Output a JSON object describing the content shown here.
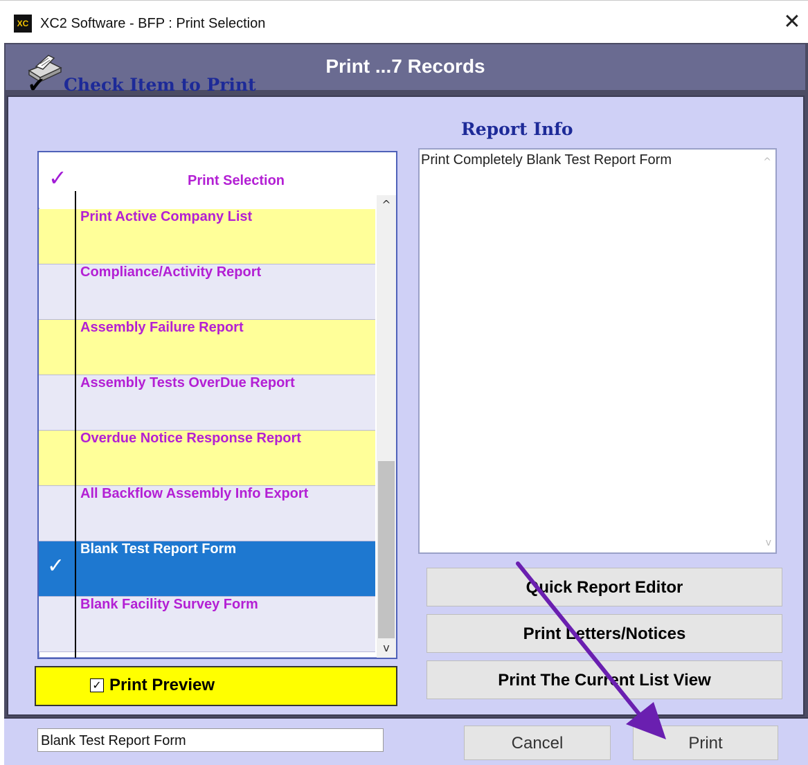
{
  "window": {
    "app_icon_text": "XC",
    "title": "XC2 Software - BFP : Print Selection",
    "close_glyph": "✕"
  },
  "header": {
    "title": "Print ...7 Records",
    "icon": "printer-icon"
  },
  "left_panel": {
    "heading_check": "✔",
    "heading": "Check Item to Print",
    "list_header_check": "✓",
    "list_header_label": "Print Selection",
    "items": [
      {
        "label": "Print Active Company List",
        "checked": false,
        "selected": false
      },
      {
        "label": "Compliance/Activity  Report",
        "checked": false,
        "selected": false
      },
      {
        "label": "Assembly Failure Report",
        "checked": false,
        "selected": false
      },
      {
        "label": "Assembly Tests OverDue Report",
        "checked": false,
        "selected": false
      },
      {
        "label": "Overdue Notice Response Report",
        "checked": false,
        "selected": false
      },
      {
        "label": "All  Backflow Assembly Info Export",
        "checked": false,
        "selected": false
      },
      {
        "label": "Blank Test Report Form",
        "checked": true,
        "selected": true
      },
      {
        "label": "Blank Facility Survey Form",
        "checked": false,
        "selected": false
      }
    ],
    "selected_check_glyph": "✓",
    "scroll_up": "^",
    "scroll_down": "v",
    "print_preview": {
      "label": "Print Preview",
      "checked": true,
      "check_glyph": "✓"
    }
  },
  "right_panel": {
    "heading": "Report Info",
    "info_text": "Print Completely Blank Test Report Form",
    "scroll_up": "^",
    "scroll_down": "v",
    "buttons": {
      "quick_report_editor": "Quick Report Editor",
      "print_letters": "Print Letters/Notices",
      "print_current_list": "Print The Current List View"
    }
  },
  "footer": {
    "status_value": "Blank Test Report Form",
    "cancel_label": "Cancel",
    "print_label": "Print"
  },
  "colors": {
    "accent_purple": "#b31fd4",
    "row_yellow": "#ffff99",
    "row_lavender": "#e8e8f6",
    "selected_blue": "#1e78d0",
    "dialog_background": "#cfd0f6",
    "header_band": "#6a6b91",
    "heading_blue": "#1d2a98",
    "annotation_arrow": "#6a1fb0"
  }
}
